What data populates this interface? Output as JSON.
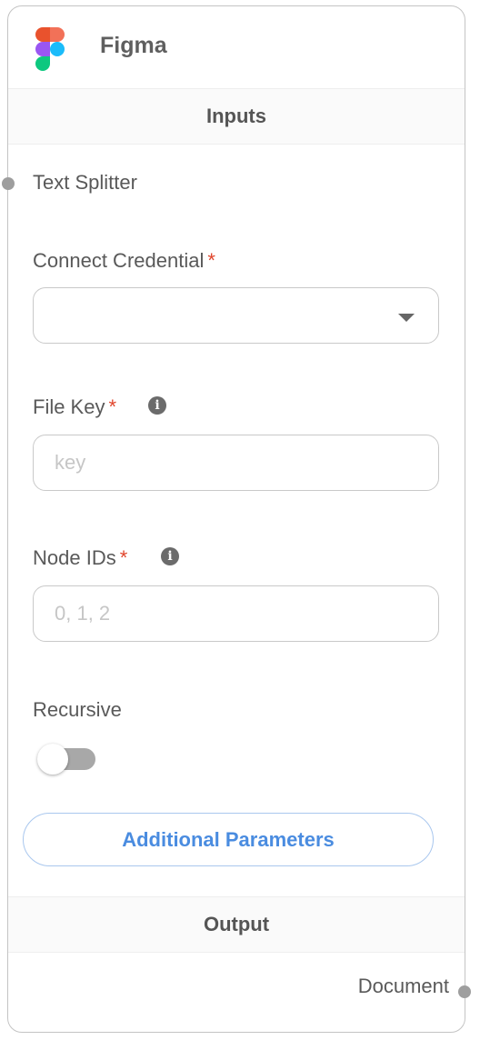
{
  "node": {
    "title": "Figma",
    "logo_icon": "figma-logo-icon"
  },
  "inputs_section": {
    "label": "Inputs",
    "anchor_label": "Text Splitter"
  },
  "credential": {
    "label": "Connect Credential",
    "required_mark": "*",
    "value": ""
  },
  "file_key": {
    "label": "File Key",
    "required_mark": "*",
    "placeholder": "key",
    "value": "",
    "info_icon": "info-icon"
  },
  "node_ids": {
    "label": "Node IDs",
    "required_mark": "*",
    "placeholder": "0, 1, 2",
    "value": "",
    "info_icon": "info-icon"
  },
  "recursive": {
    "label": "Recursive",
    "enabled": false
  },
  "additional_parameters": {
    "label": "Additional Parameters"
  },
  "output_section": {
    "label": "Output",
    "anchor_label": "Document"
  },
  "colors": {
    "required": "#e0452c",
    "accent": "#4a8ce0",
    "handle": "#9e9e9e"
  }
}
